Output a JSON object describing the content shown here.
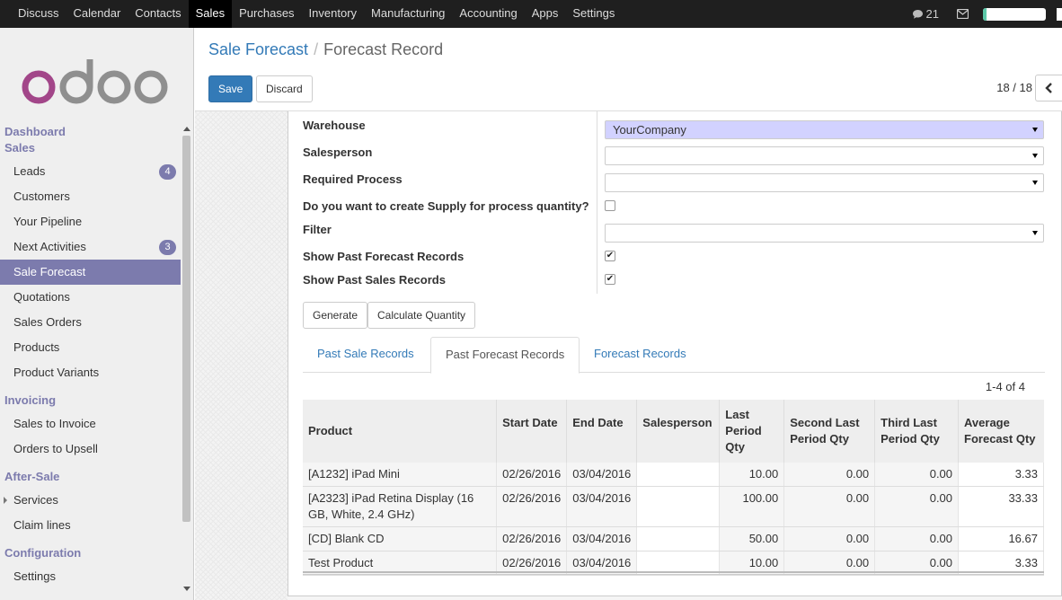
{
  "topbar": {
    "menu": [
      "Discuss",
      "Calendar",
      "Contacts",
      "Sales",
      "Purchases",
      "Inventory",
      "Manufacturing",
      "Accounting",
      "Apps",
      "Settings"
    ],
    "active_menu": "Sales",
    "chat_count": "21",
    "progress_fraction": 0.06
  },
  "sidebar": {
    "dashboard_heading": "Dashboard",
    "sales_heading": "Sales",
    "sales_items": [
      {
        "label": "Leads",
        "badge": "4"
      },
      {
        "label": "Customers"
      },
      {
        "label": "Your Pipeline"
      },
      {
        "label": "Next Activities",
        "badge": "3"
      },
      {
        "label": "Sale Forecast"
      },
      {
        "label": "Quotations"
      },
      {
        "label": "Sales Orders"
      },
      {
        "label": "Products"
      },
      {
        "label": "Product Variants"
      }
    ],
    "invoicing_heading": "Invoicing",
    "invoicing_items": [
      {
        "label": "Sales to Invoice"
      },
      {
        "label": "Orders to Upsell"
      }
    ],
    "aftersale_heading": "After-Sale",
    "aftersale_items": [
      {
        "label": "Services"
      },
      {
        "label": "Claim lines"
      }
    ],
    "configuration_heading": "Configuration",
    "configuration_items": [
      {
        "label": "Settings"
      }
    ]
  },
  "control_panel": {
    "breadcrumb_parent": "Sale Forecast",
    "breadcrumb_current": "Forecast Record",
    "save_label": "Save",
    "discard_label": "Discard",
    "pager": "18 / 18"
  },
  "form": {
    "warehouse_label": "Warehouse",
    "warehouse_value": "YourCompany",
    "salesperson_label": "Salesperson",
    "salesperson_value": "",
    "process_label": "Required Process",
    "process_value": "",
    "supply_label": "Do you want to create Supply for process quantity?",
    "supply_checked": false,
    "filter_label": "Filter",
    "filter_value": "",
    "past_forecast_label": "Show Past Forecast Records",
    "past_forecast_checked": true,
    "past_sales_label": "Show Past Sales Records",
    "past_sales_checked": true,
    "generate_label": "Generate",
    "calculate_label": "Calculate Quantity"
  },
  "tabs": {
    "past_sale": "Past Sale Records",
    "past_forecast": "Past Forecast Records",
    "forecast": "Forecast Records",
    "active": "Past Forecast Records"
  },
  "table": {
    "counter": "1-4 of 4",
    "headers": {
      "product": "Product",
      "start_date": "Start Date",
      "end_date": "End Date",
      "salesperson": "Salesperson",
      "last": "Last Period Qty",
      "second": "Second Last Period Qty",
      "third": "Third Last Period Qty",
      "average": "Average Forecast Qty"
    },
    "rows": [
      {
        "product": "[A1232] iPad Mini",
        "start": "02/26/2016",
        "end": "03/04/2016",
        "salesperson": "",
        "last": "10.00",
        "second": "0.00",
        "third": "0.00",
        "average": "3.33"
      },
      {
        "product": "[A2323] iPad Retina Display (16 GB, White, 2.4 GHz)",
        "start": "02/26/2016",
        "end": "03/04/2016",
        "salesperson": "",
        "last": "100.00",
        "second": "0.00",
        "third": "0.00",
        "average": "33.33"
      },
      {
        "product": "[CD] Blank CD",
        "start": "02/26/2016",
        "end": "03/04/2016",
        "salesperson": "",
        "last": "50.00",
        "second": "0.00",
        "third": "0.00",
        "average": "16.67"
      },
      {
        "product": "Test Product",
        "start": "02/26/2016",
        "end": "03/04/2016",
        "salesperson": "",
        "last": "10.00",
        "second": "0.00",
        "third": "0.00",
        "average": "3.33"
      }
    ]
  }
}
